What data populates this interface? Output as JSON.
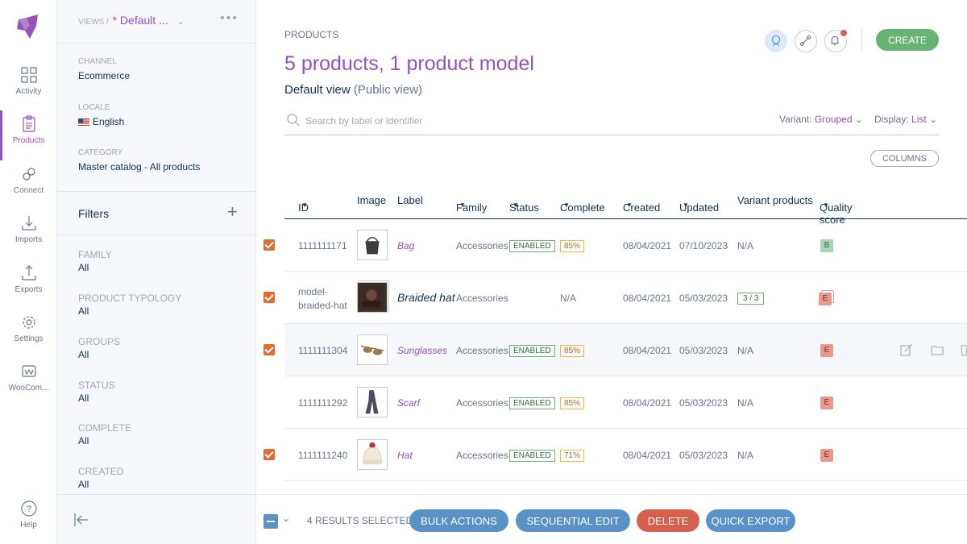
{
  "rail": {
    "items": [
      {
        "label": "Activity",
        "icon": "activity-icon"
      },
      {
        "label": "Products",
        "icon": "products-icon"
      },
      {
        "label": "Connect",
        "icon": "connect-icon"
      },
      {
        "label": "Imports",
        "icon": "imports-icon"
      },
      {
        "label": "Exports",
        "icon": "exports-icon"
      },
      {
        "label": "Settings",
        "icon": "settings-icon"
      },
      {
        "label": "WooCom...",
        "icon": "woocommerce-icon"
      }
    ],
    "help": "Help",
    "accent": "#9452ba"
  },
  "panel": {
    "views_prefix": "VIEWS /",
    "view_name": "* Default ...",
    "channel_label": "CHANNEL",
    "channel_value": "Ecommerce",
    "locale_label": "LOCALE",
    "locale_value": "English",
    "category_label": "CATEGORY",
    "category_value": "Master catalog - All products",
    "filters_title": "Filters",
    "filters": [
      {
        "label": "FAMILY",
        "value": "All"
      },
      {
        "label": "PRODUCT TYPOLOGY",
        "value": "All"
      },
      {
        "label": "GROUPS",
        "value": "All"
      },
      {
        "label": "STATUS",
        "value": "All"
      },
      {
        "label": "COMPLETE",
        "value": "All"
      },
      {
        "label": "CREATED",
        "value": "All"
      }
    ]
  },
  "header": {
    "breadcrumb": "PRODUCTS",
    "title": "5 products, 1 product model",
    "view": "Default view",
    "view_type": "(Public view)",
    "create_label": "CREATE"
  },
  "search": {
    "placeholder": "Search by label or identifier",
    "variant_label": "Variant:",
    "variant_value": "Grouped",
    "display_label": "Display:",
    "display_value": "List"
  },
  "columns_label": "COLUMNS",
  "table": {
    "headers": {
      "id": "ID",
      "image": "Image",
      "label": "Label",
      "family": "Family",
      "status": "Status",
      "complete": "Complete",
      "created": "Created",
      "updated": "Updated",
      "variant": "Variant products",
      "quality": "Quality score"
    },
    "rows": [
      {
        "id": "1111111171",
        "label": "Bag",
        "family": "Accessories",
        "status": "ENABLED",
        "complete": "85%",
        "created": "08/04/2021",
        "updated": "07/10/2023",
        "variant": "N/A",
        "quality": "B",
        "checked": true
      },
      {
        "id": "model-\nbraided-hat",
        "label": "Braided hat",
        "family": "Accessories",
        "status": "",
        "complete": "N/A",
        "created": "08/04/2021",
        "updated": "05/03/2023",
        "variant": "3 / 3",
        "quality": "E",
        "checked": true
      },
      {
        "id": "1111111304",
        "label": "Sunglasses",
        "family": "Accessories",
        "status": "ENABLED",
        "complete": "85%",
        "created": "08/04/2021",
        "updated": "05/03/2023",
        "variant": "N/A",
        "quality": "E",
        "checked": true
      },
      {
        "id": "1111111292",
        "label": "Scarf",
        "family": "Accessories",
        "status": "ENABLED",
        "complete": "85%",
        "created": "08/04/2021",
        "updated": "05/03/2023",
        "variant": "N/A",
        "quality": "E",
        "checked": false
      },
      {
        "id": "1111111240",
        "label": "Hat",
        "family": "Accessories",
        "status": "ENABLED",
        "complete": "71%",
        "created": "08/04/2021",
        "updated": "05/03/2023",
        "variant": "N/A",
        "quality": "E",
        "checked": true
      }
    ]
  },
  "bottom": {
    "selected": "4 RESULTS SELECTED",
    "bulk_actions": "BULK ACTIONS",
    "sequential_edit": "SEQUENTIAL EDIT",
    "delete": "DELETE",
    "quick_export": "QUICK EXPORT"
  }
}
